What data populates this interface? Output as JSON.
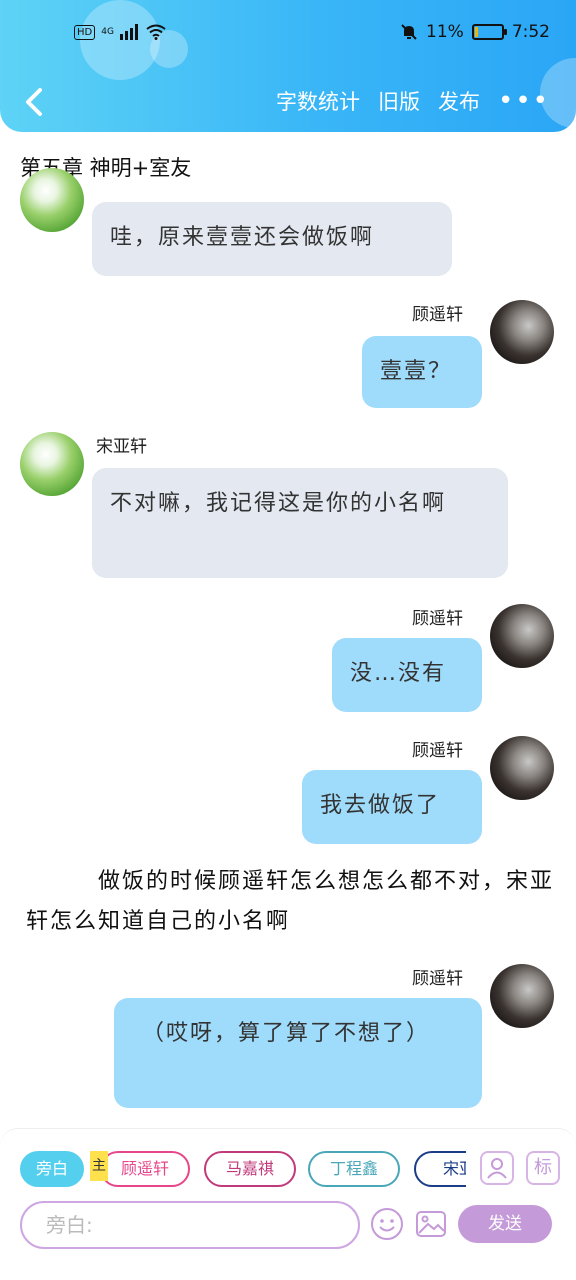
{
  "status_bar": {
    "network_badge": "HD",
    "network": "4G",
    "battery_text": "11%",
    "battery_level": 0.11,
    "time": "7:52"
  },
  "nav": {
    "word_count": "字数统计",
    "old_version": "旧版",
    "publish": "发布",
    "more": "•••"
  },
  "chapter_title": "第五章 神明+室友",
  "messages": [
    {
      "side": "left",
      "text": "哇，原来壹壹还会做饭啊"
    },
    {
      "side": "right",
      "name": "顾遥轩",
      "text": "壹壹？"
    },
    {
      "side": "left",
      "name": "宋亚轩",
      "text": "不对嘛，我记得这是你的小名啊"
    },
    {
      "side": "right",
      "name": "顾遥轩",
      "text": "没…没有"
    },
    {
      "side": "right",
      "name": "顾遥轩",
      "text": "我去做饭了"
    },
    {
      "side": "right",
      "name": "顾遥轩",
      "text": "（哎呀，算了算了不想了）"
    }
  ],
  "narration": "做饭的时候顾遥轩怎么想怎么都不对，宋亚轩怎么知道自己的小名啊",
  "composer": {
    "chips": [
      "旁白",
      "顾遥轩",
      "马嘉祺",
      "丁程鑫",
      "宋亚"
    ],
    "main_tag": "主",
    "mark_label": "标",
    "input_placeholder": "旁白:",
    "send": "发送"
  },
  "colors": {
    "header": "#39b6f7",
    "bubble_left": "#e3e8f1",
    "bubble_right": "#9fdbfa",
    "accent": "#c59ad9"
  },
  "icons": [
    "back-icon",
    "mute-icon",
    "wifi-icon",
    "battery-icon",
    "person-icon",
    "emoji-icon",
    "image-icon"
  ]
}
